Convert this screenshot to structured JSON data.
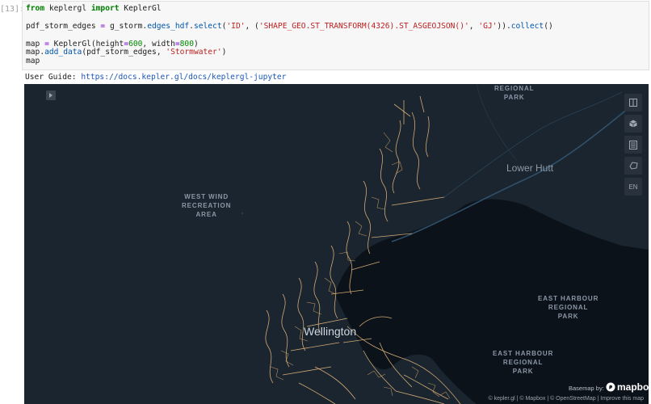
{
  "cell": {
    "prompt": "[13]:",
    "code_lines": [
      [
        {
          "t": "from",
          "c": "kw"
        },
        {
          "t": " keplergl "
        },
        {
          "t": "import",
          "c": "kw"
        },
        {
          "t": " KeplerGl"
        }
      ],
      [
        {
          "t": ""
        }
      ],
      [
        {
          "t": "pdf_storm_edges "
        },
        {
          "t": "=",
          "c": "op"
        },
        {
          "t": " g_storm."
        },
        {
          "t": "edges_hdf",
          "c": "fn"
        },
        {
          "t": "."
        },
        {
          "t": "select",
          "c": "fn"
        },
        {
          "t": "("
        },
        {
          "t": "'ID'",
          "c": "str"
        },
        {
          "t": ", ("
        },
        {
          "t": "'SHAPE_GEO.ST_TRANSFORM(4326).ST_ASGEOJSON()'",
          "c": "str"
        },
        {
          "t": ", "
        },
        {
          "t": "'GJ'",
          "c": "str"
        },
        {
          "t": "))."
        },
        {
          "t": "collect",
          "c": "fn"
        },
        {
          "t": "()"
        }
      ],
      [
        {
          "t": ""
        }
      ],
      [
        {
          "t": "map "
        },
        {
          "t": "=",
          "c": "op"
        },
        {
          "t": " KeplerGl(height"
        },
        {
          "t": "=",
          "c": "op"
        },
        {
          "t": "600",
          "c": "num"
        },
        {
          "t": ", width"
        },
        {
          "t": "=",
          "c": "op"
        },
        {
          "t": "800",
          "c": "num"
        },
        {
          "t": ")"
        }
      ],
      [
        {
          "t": "map."
        },
        {
          "t": "add_data",
          "c": "fn"
        },
        {
          "t": "(pdf_storm_edges, "
        },
        {
          "t": "'Stormwater'",
          "c": "str"
        },
        {
          "t": ")"
        }
      ],
      [
        {
          "t": "map"
        }
      ]
    ]
  },
  "output": {
    "guide_prefix": "User Guide: ",
    "guide_link": "https://docs.kepler.gl/docs/keplergl-jupyter"
  },
  "map": {
    "labels": {
      "regional_park_top": "REGIONAL\nPARK",
      "west_wind": "WEST WIND\nRECREATION\nAREA",
      "east_harbour_1": "EAST HARBOUR\nREGIONAL\nPARK",
      "east_harbour_2": "EAST HARBOUR\nREGIONAL\nPARK",
      "lower_hutt": "Lower Hutt",
      "wellington": "Wellington"
    },
    "controls": {
      "language": "EN"
    },
    "basemap_label": "Basemap by:",
    "mapbox_label": "mapbox",
    "attribution": "© kepler.gl | © Mapbox | © OpenStreetMap | Improve this map",
    "colors": {
      "land": "#1a2530",
      "water": "#0b121a",
      "stormwater": "#e5b87a",
      "road": "#30506a"
    }
  }
}
